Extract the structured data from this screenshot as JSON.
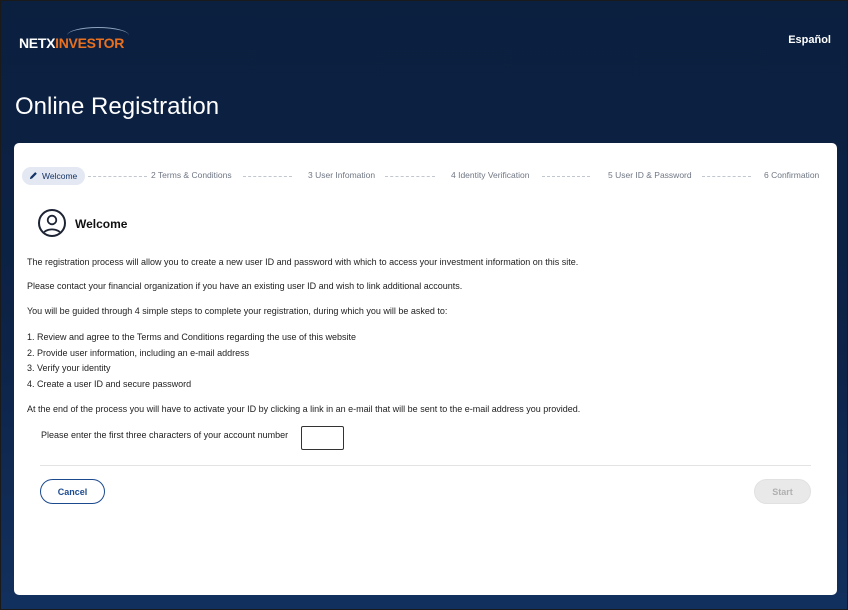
{
  "header": {
    "logo_netx": "NETX",
    "logo_investor": "INVESTOR",
    "language_link": "Español"
  },
  "page": {
    "title": "Online Registration"
  },
  "steps": [
    {
      "label": "Welcome",
      "active": true
    },
    {
      "label": "2 Terms & Conditions"
    },
    {
      "label": "3 User Infomation"
    },
    {
      "label": "4 Identity Verification"
    },
    {
      "label": "5 User ID & Password"
    },
    {
      "label": "6 Confirmation"
    }
  ],
  "welcome": {
    "title": "Welcome",
    "paragraphs": [
      "The registration process will allow you to create a new user ID and password with which to access your investment information on this site.",
      "Please contact your financial organization if you have an existing user ID and wish to link additional accounts.",
      "You will be guided through 4 simple steps to complete your registration, during which you will be asked to:"
    ],
    "list": [
      "1. Review and agree to the Terms and Conditions regarding the use of this website",
      "2. Provide user information, including an e-mail address",
      "3. Verify your identity",
      "4. Create a user ID and secure password"
    ],
    "closing": "At the end of the process you will have to activate your ID by clicking a link in an e-mail that will be sent to the e-mail address you provided."
  },
  "account_prompt": {
    "label": "Please enter the first three characters of your account number",
    "value": ""
  },
  "buttons": {
    "cancel": "Cancel",
    "start": "Start"
  }
}
